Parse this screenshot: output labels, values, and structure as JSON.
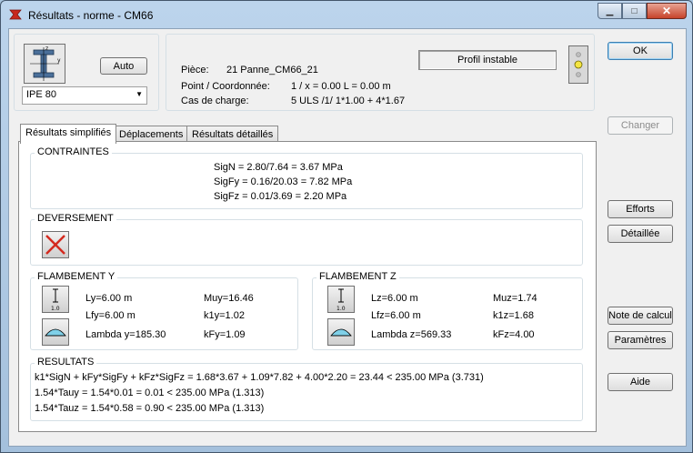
{
  "window": {
    "title": "Résultats - norme - CM66",
    "minimize": "▁",
    "maximize": "□",
    "close": "✕"
  },
  "profile": {
    "auto_label": "Auto",
    "section_value": "IPE 80"
  },
  "info": {
    "piece_label": "Pièce:",
    "piece_value": "21  Panne_CM66_21",
    "point_label": "Point / Coordonnée:",
    "point_value": "1 / x = 0.00 L = 0.00 m",
    "case_label": "Cas de charge:",
    "case_value": "5 ULS /1/  1*1.00 + 4*1.67",
    "status": "Profil instable"
  },
  "buttons": {
    "ok": "OK",
    "changer": "Changer",
    "efforts": "Efforts",
    "detaillee": "Détaillée",
    "note": "Note de calcul",
    "parametres": "Paramètres",
    "aide": "Aide"
  },
  "tabs": [
    {
      "label": "Résultats simplifiés"
    },
    {
      "label": "Déplacements"
    },
    {
      "label": "Résultats détaillés"
    }
  ],
  "contraintes": {
    "title": "CONTRAINTES",
    "lines": [
      "SigN = 2.80/7.64 = 3.67 MPa",
      "SigFy = 0.16/20.03 = 7.82 MPa",
      "SigFz = 0.01/3.69 = 2.20 MPa"
    ]
  },
  "deversement": {
    "title": "DEVERSEMENT"
  },
  "flambement_y": {
    "title": "FLAMBEMENT Y",
    "ly": "Ly=6.00 m",
    "lfy": "Lfy=6.00 m",
    "lambda": "Lambda y=185.30",
    "mu": "Muy=16.46",
    "k": "k1y=1.02",
    "kf": "kFy=1.09",
    "icon_label": "1.0"
  },
  "flambement_z": {
    "title": "FLAMBEMENT Z",
    "lz": "Lz=6.00 m",
    "lfz": "Lfz=6.00 m",
    "lambda": "Lambda z=569.33",
    "mu": "Muz=1.74",
    "k": "k1z=1.68",
    "kf": "kFz=4.00",
    "icon_label": "1.0"
  },
  "resultats": {
    "title": "RESULTATS",
    "lines": [
      "k1*SigN + kFy*SigFy + kFz*SigFz = 1.68*3.67 + 1.09*7.82 + 4.00*2.20 =  23.44   < 235.00 MPa  (3.731)",
      "1.54*Tauy = 1.54*0.01 = 0.01 < 235.00 MPa   (1.313)",
      "1.54*Tauz = 1.54*0.58 = 0.90 < 235.00 MPa   (1.313)"
    ]
  },
  "colors": {
    "error_red": "#d42a1f",
    "signal_yellow": "#f4e542",
    "accent_blue": "#3c7fb1"
  }
}
